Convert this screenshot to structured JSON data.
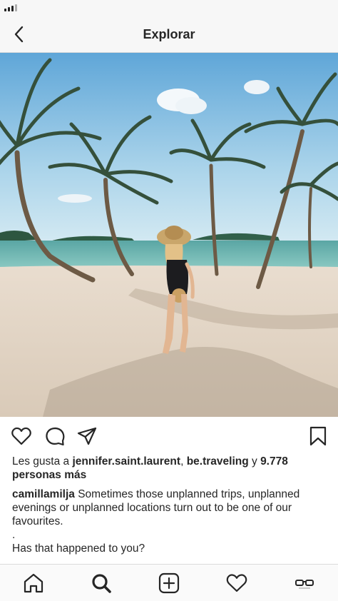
{
  "header": {
    "title": "Explorar",
    "back_icon": "chevron-left-icon"
  },
  "post": {
    "image_icon": "beach-photo",
    "actions": {
      "like_icon": "heart-outline-icon",
      "comment_icon": "comment-bubble-icon",
      "share_icon": "paper-plane-icon",
      "save_icon": "bookmark-icon"
    },
    "likes": {
      "prefix": "Les gusta a ",
      "user1": "jennifer.saint.laurent",
      "separator": ", ",
      "user2": "be.traveling",
      "conj": " y ",
      "count": "9.778",
      "suffix": "personas más"
    },
    "caption": {
      "username": "camillamilja",
      "line1": " Sometimes those unplanned trips, unplanned",
      "line2": "evenings or unplanned locations turn out to be one of our",
      "line3": "favourites.",
      "line4": ".",
      "line5": "Has that happened to you?"
    }
  },
  "tab_bar": {
    "home_icon": "home-icon",
    "search_icon": "search-icon",
    "add_icon": "add-post-icon",
    "activity_icon": "heart-icon",
    "profile_icon": "glasses-avatar-icon"
  },
  "colors": {
    "text": "#262626",
    "bar_background": "#f7f7f7",
    "divider": "#dbdbdb"
  }
}
